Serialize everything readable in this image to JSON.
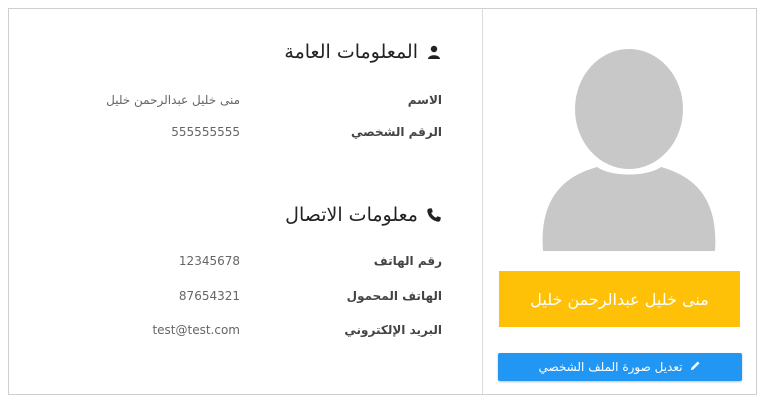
{
  "general_info": {
    "title": "المعلومات العامة",
    "icon": "user-icon",
    "fields": [
      {
        "label": "الاسم",
        "value": "منى خليل عبدالرحمن خليل"
      },
      {
        "label": "الرقم الشخصي",
        "value": "555555555"
      }
    ]
  },
  "contact_info": {
    "title": "معلومات الاتصال",
    "icon": "phone-icon",
    "fields": [
      {
        "label": "رقم الهاتف",
        "value": "12345678"
      },
      {
        "label": "الهاتف المحمول",
        "value": "87654321"
      },
      {
        "label": "البريد الإلكتروني",
        "value": "test@test.com"
      }
    ]
  },
  "profile": {
    "name": "منى خليل عبدالرحمن خليل",
    "edit_button_label": "تعديل صورة الملف الشخصي",
    "edit_icon": "pencil-icon"
  },
  "colors": {
    "name_bar": "#ffc107",
    "edit_button": "#2196f3",
    "avatar": "#c8c8c8"
  }
}
